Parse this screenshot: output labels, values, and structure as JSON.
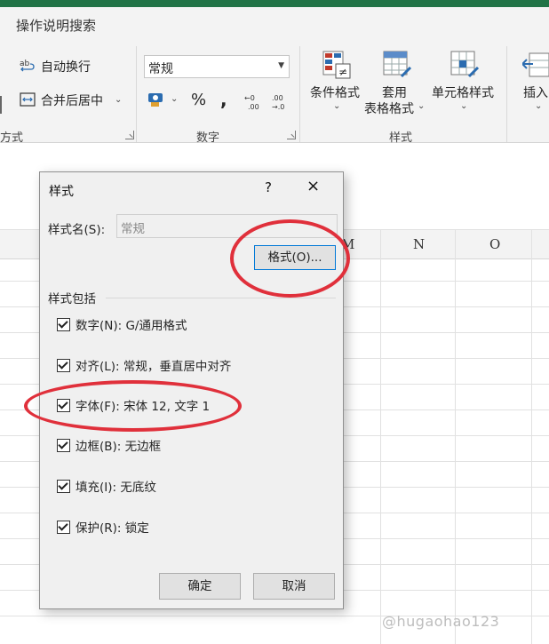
{
  "app": {
    "accent_color": "#217346"
  },
  "ribbon": {
    "search_label": "操作说明搜索",
    "alignment": {
      "wrap_text_label": "自动换行",
      "merge_center_label": "合并后居中",
      "group_label_partial": "方式"
    },
    "number": {
      "format_value": "常规",
      "percent_label": "%",
      "comma_label": ",",
      "group_label": "数字"
    },
    "styles": {
      "conditional_format_label": "条件格式",
      "table_format_line1": "套用",
      "table_format_line2": "表格格式",
      "cell_styles_label": "单元格样式",
      "group_label": "样式"
    },
    "cells": {
      "insert_label": "插入"
    }
  },
  "sheet": {
    "column_headers": [
      "M",
      "N",
      "O"
    ]
  },
  "dialog": {
    "title": "样式",
    "help_label": "?",
    "close_label": "×",
    "style_name_label": "样式名(S):",
    "style_name_value": "常规",
    "format_button_label": "格式(O)...",
    "includes_label": "样式包括",
    "options": [
      {
        "label": "数字(N): G/通用格式",
        "checked": true
      },
      {
        "label": "对齐(L): 常规，垂直居中对齐",
        "checked": true
      },
      {
        "label": "字体(F): 宋体 12, 文字 1",
        "checked": true
      },
      {
        "label": "边框(B): 无边框",
        "checked": true
      },
      {
        "label": "填充(I): 无底纹",
        "checked": true
      },
      {
        "label": "保护(R): 锁定",
        "checked": true
      }
    ],
    "ok_label": "确定",
    "cancel_label": "取消"
  },
  "annotations": {
    "highlight_color": "#e0303b"
  },
  "watermark": "@hugaohao123"
}
